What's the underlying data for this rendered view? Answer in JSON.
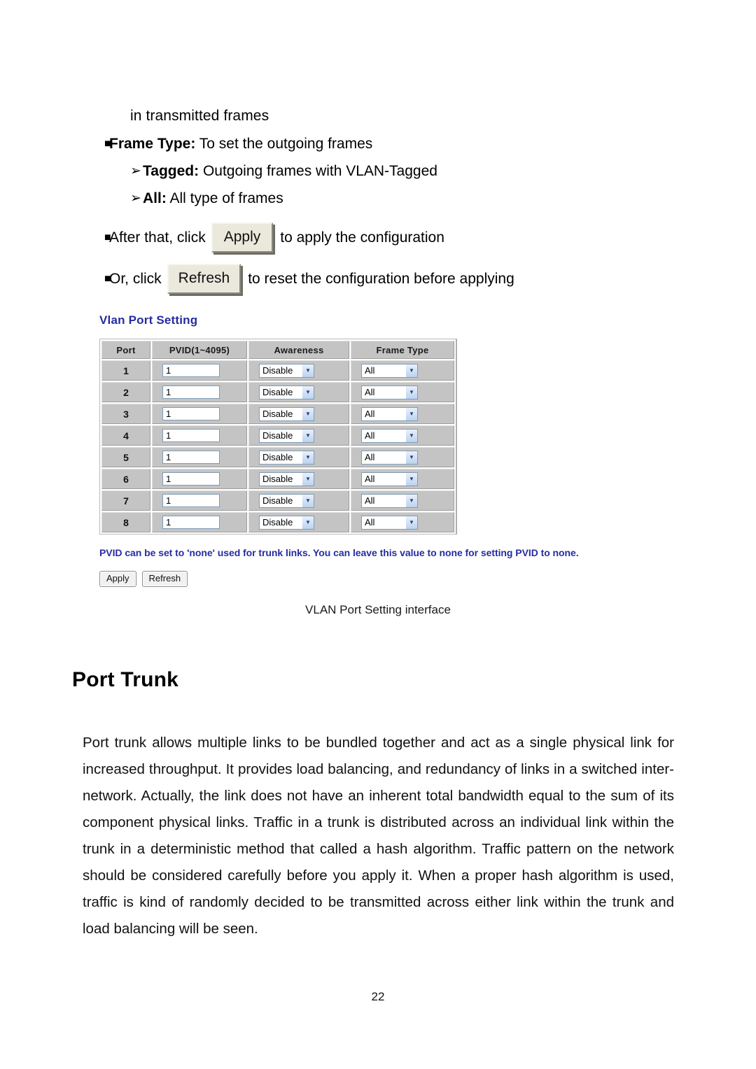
{
  "document": {
    "page_number": "22",
    "figure_caption": "VLAN Port Setting interface",
    "section_heading": "Port Trunk",
    "paragraph": "Port trunk allows multiple links to be bundled together and act as a single physical link for increased throughput. It provides load balancing, and redundancy of links in a switched inter-network. Actually, the link does not have an inherent total bandwidth equal to the sum of its component physical links. Traffic in a trunk is distributed across an individual link within the trunk in a deterministic method that called a hash algorithm. Traffic pattern on the network should be considered carefully before you apply it. When a proper hash algorithm is used, traffic is kind of randomly decided to be transmitted across either link within the trunk and load balancing will be seen."
  },
  "instructions": {
    "continued_line": "in transmitted frames",
    "bullets": [
      {
        "marker": "■",
        "term": "Frame Type:",
        "text": " To set the outgoing frames"
      }
    ],
    "sub_bullets": [
      {
        "marker": "➢",
        "term": "Tagged:",
        "text": " Outgoing frames with VLAN-Tagged"
      },
      {
        "marker": "➢",
        "term": "All:",
        "text": " All type of frames"
      }
    ],
    "apply_line": {
      "marker": "■",
      "before": "After that, click",
      "button_label": "Apply",
      "after": "to apply the configuration"
    },
    "refresh_line": {
      "marker": "■",
      "before": "Or, click",
      "button_label": "Refresh",
      "after": "to reset the configuration before applying"
    }
  },
  "vlan_ui": {
    "title": "Vlan Port Setting",
    "title_color": "#242ca0",
    "note": "PVID can be set to 'none' used for trunk links. You can leave this value to none for setting PVID to none.",
    "note_color": "#262ca2",
    "columns": [
      "Port",
      "PVID(1~4095)",
      "Awareness",
      "Frame Type"
    ],
    "rows": [
      {
        "port": "1",
        "pvid": "1",
        "awareness": "Disable",
        "frame_type": "All"
      },
      {
        "port": "2",
        "pvid": "1",
        "awareness": "Disable",
        "frame_type": "All"
      },
      {
        "port": "3",
        "pvid": "1",
        "awareness": "Disable",
        "frame_type": "All"
      },
      {
        "port": "4",
        "pvid": "1",
        "awareness": "Disable",
        "frame_type": "All"
      },
      {
        "port": "5",
        "pvid": "1",
        "awareness": "Disable",
        "frame_type": "All"
      },
      {
        "port": "6",
        "pvid": "1",
        "awareness": "Disable",
        "frame_type": "All"
      },
      {
        "port": "7",
        "pvid": "1",
        "awareness": "Disable",
        "frame_type": "All"
      },
      {
        "port": "8",
        "pvid": "1",
        "awareness": "Disable",
        "frame_type": "All"
      }
    ],
    "buttons": {
      "apply": "Apply",
      "refresh": "Refresh"
    },
    "dropdown_arrow": "▼"
  }
}
